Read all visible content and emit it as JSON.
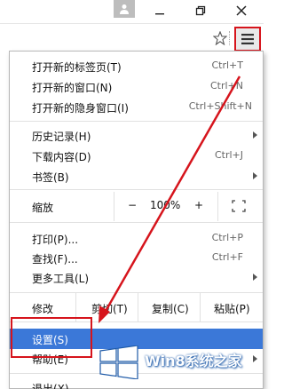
{
  "menu_items": [
    {
      "label": "打开新的标签页(T)",
      "shortcut": "Ctrl+T"
    },
    {
      "label": "打开新的窗口(N)",
      "shortcut": "Ctrl+N"
    },
    {
      "label": "打开新的隐身窗口(I)",
      "shortcut": "Ctrl+Shift+N"
    },
    {
      "label": "历史记录(H)",
      "shortcut": ""
    },
    {
      "label": "下载内容(D)",
      "shortcut": "Ctrl+J"
    },
    {
      "label": "书签(B)",
      "shortcut": ""
    },
    {
      "label": "打印(P)...",
      "shortcut": "Ctrl+P"
    },
    {
      "label": "查找(F)...",
      "shortcut": "Ctrl+F"
    },
    {
      "label": "更多工具(L)",
      "shortcut": ""
    }
  ],
  "zoom": {
    "label": "缩放",
    "minus": "−",
    "value": "100%",
    "plus": "+"
  },
  "edit": {
    "label": "修改",
    "cut": "剪切(T)",
    "copy": "复制(C)",
    "paste": "粘贴(P)"
  },
  "settings_label": "设置(S)",
  "help_label": "帮助(E)",
  "exit_label": "退出(X)",
  "watermark": "Win8系统之家",
  "colors": {
    "highlight": "#3b78d8",
    "annotation": "#d6141c"
  },
  "icons": [
    "user-icon",
    "minimize-icon",
    "restore-icon",
    "close-icon",
    "star-icon",
    "hamburger-menu-icon",
    "fullscreen-icon",
    "windows-logo-icon"
  ]
}
